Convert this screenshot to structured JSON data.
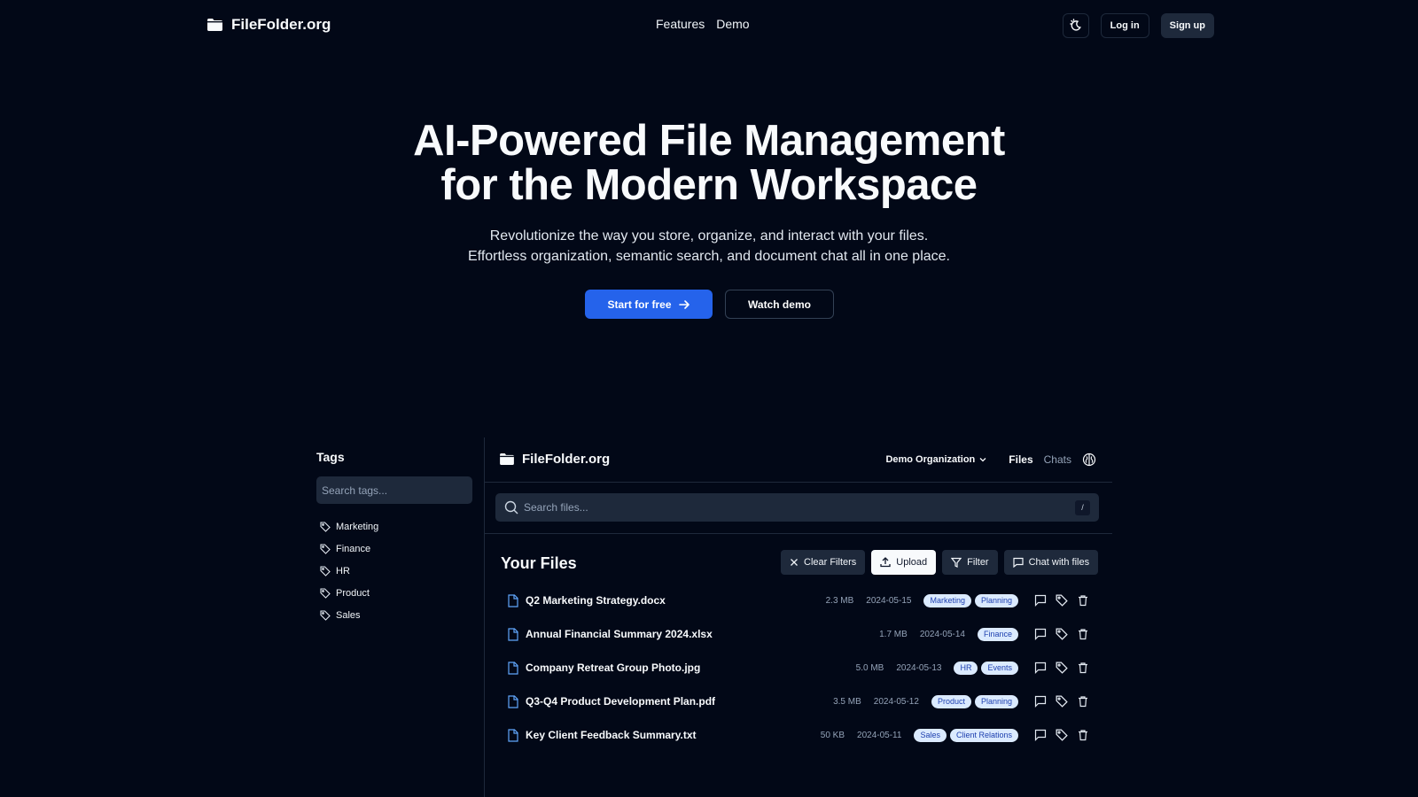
{
  "nav": {
    "brand": "FileFolder.org",
    "links": [
      "Features",
      "Demo"
    ],
    "login": "Log in",
    "signup": "Sign up",
    "icons": {
      "brand": "folder-icon",
      "theme": "theme-toggle-icon"
    }
  },
  "hero": {
    "title_line1": "AI-Powered File Management",
    "title_line2": "for the Modern Workspace",
    "subtitle_line1": "Revolutionize the way you store, organize, and interact with your files.",
    "subtitle_line2": "Effortless organization, semantic search, and document chat all in one place.",
    "cta_primary": "Start for free",
    "cta_secondary": "Watch demo"
  },
  "demo": {
    "sidebar": {
      "title": "Tags",
      "search_placeholder": "Search tags...",
      "tags": [
        "Marketing",
        "Finance",
        "HR",
        "Product",
        "Sales"
      ]
    },
    "header": {
      "brand": "FileFolder.org",
      "organization": "Demo Organization",
      "tab_files": "Files",
      "tab_chats": "Chats"
    },
    "search": {
      "placeholder": "Search files...",
      "shortcut": "/"
    },
    "files_title": "Your Files",
    "toolbar": {
      "clear_filters": "Clear Filters",
      "upload": "Upload",
      "filter": "Filter",
      "chat": "Chat with files"
    },
    "files": [
      {
        "name": "Q2 Marketing Strategy.docx",
        "size": "2.3 MB",
        "date": "2024-05-15",
        "tags": [
          "Marketing",
          "Planning"
        ]
      },
      {
        "name": "Annual Financial Summary 2024.xlsx",
        "size": "1.7 MB",
        "date": "2024-05-14",
        "tags": [
          "Finance"
        ]
      },
      {
        "name": "Company Retreat Group Photo.jpg",
        "size": "5.0 MB",
        "date": "2024-05-13",
        "tags": [
          "HR",
          "Events"
        ]
      },
      {
        "name": "Q3-Q4 Product Development Plan.pdf",
        "size": "3.5 MB",
        "date": "2024-05-12",
        "tags": [
          "Product",
          "Planning"
        ]
      },
      {
        "name": "Key Client Feedback Summary.txt",
        "size": "50 KB",
        "date": "2024-05-11",
        "tags": [
          "Sales",
          "Client Relations"
        ]
      }
    ]
  },
  "colors": {
    "background": "#020817",
    "primary": "#2563eb",
    "surface": "#1e293b",
    "badge_bg": "#dbeafe",
    "badge_text": "#1e40af"
  }
}
